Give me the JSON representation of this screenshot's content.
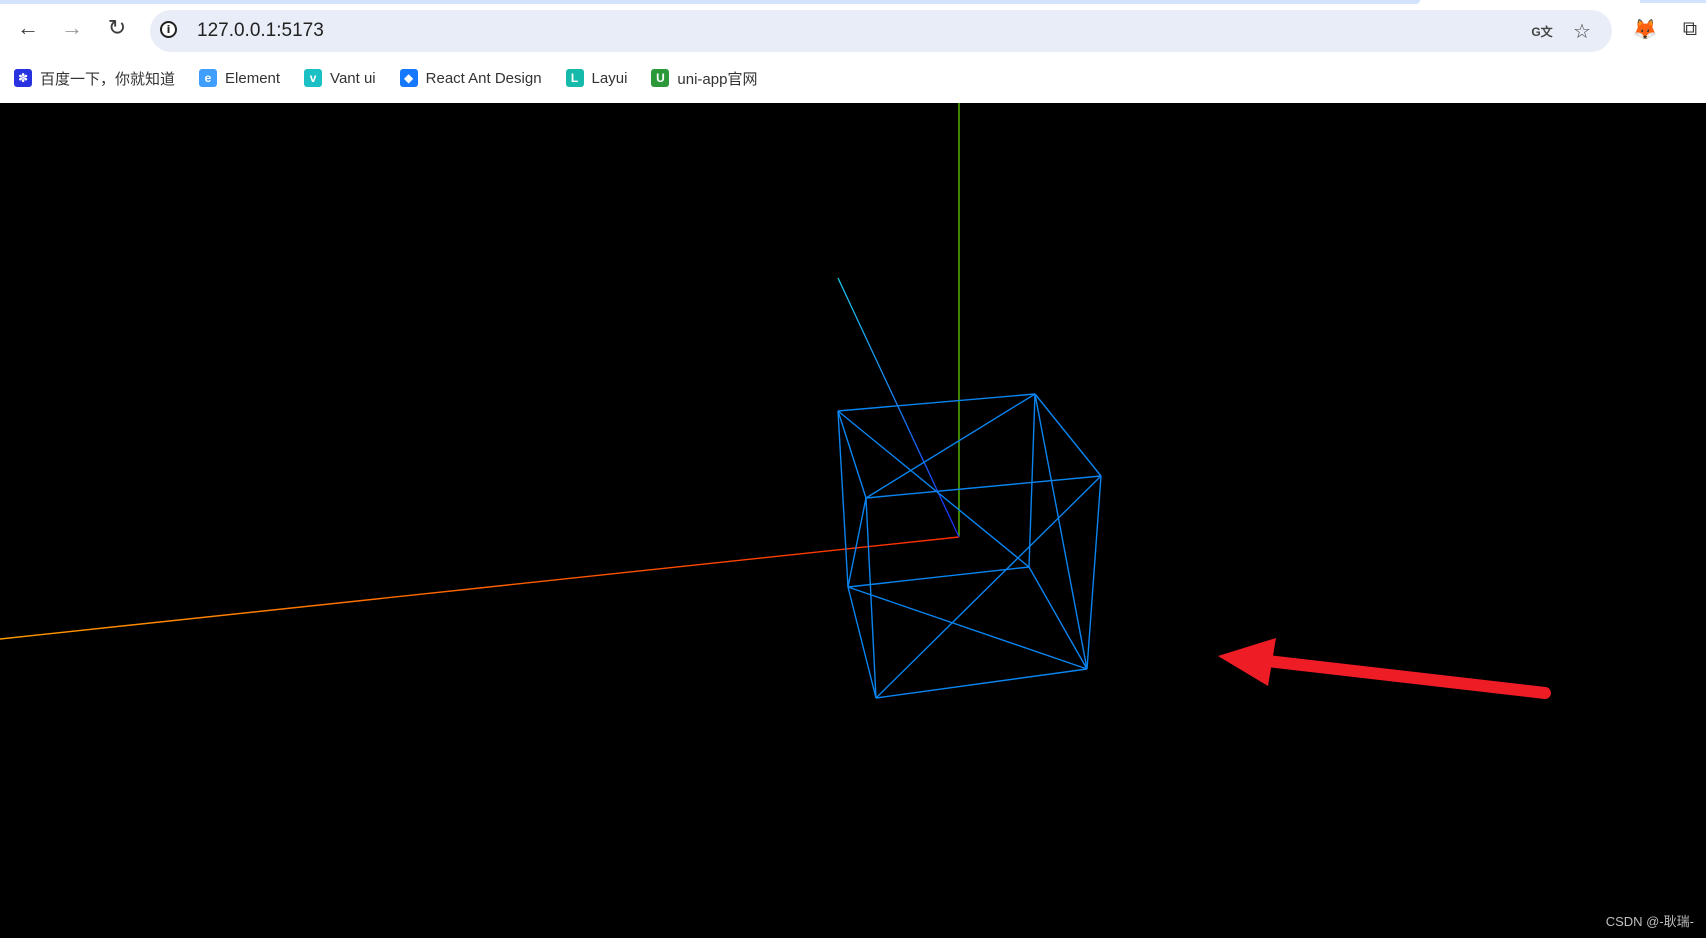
{
  "browser": {
    "url": "127.0.0.1:5173",
    "nav": {
      "back_icon": "←",
      "forward_icon": "→",
      "reload_icon": "↻"
    },
    "omnibox_icons": {
      "translate_icon": "G文",
      "bookmark_star_icon": "☆"
    },
    "extensions": {
      "metamask_icon": "🦊",
      "extensions_icon": "⧉"
    }
  },
  "bookmarks": [
    {
      "label": "百度一下，你就知道",
      "icon": "baidu-paw",
      "color": "#2932e1",
      "glyph": "✽"
    },
    {
      "label": "Element",
      "icon": "element-logo",
      "color": "#409eff",
      "glyph": "e"
    },
    {
      "label": "Vant ui",
      "icon": "vant-logo",
      "color": "#1bc0c4",
      "glyph": "v"
    },
    {
      "label": "React Ant Design",
      "icon": "antd-logo",
      "color": "#1677ff",
      "glyph": "◆"
    },
    {
      "label": "Layui",
      "icon": "layui-logo",
      "color": "#16baaa",
      "glyph": "L"
    },
    {
      "label": "uni-app官网",
      "icon": "uniapp-logo",
      "color": "#2b9939",
      "glyph": "U"
    }
  ],
  "scene": {
    "background": "#000000",
    "wireframe_color": "#0a84f0",
    "axis_colors": {
      "x": "#ff4400",
      "y": "#66dd00",
      "z": "#2255ff"
    },
    "arrow_color": "#ee1c25"
  },
  "watermark": "CSDN @-耿瑞-"
}
